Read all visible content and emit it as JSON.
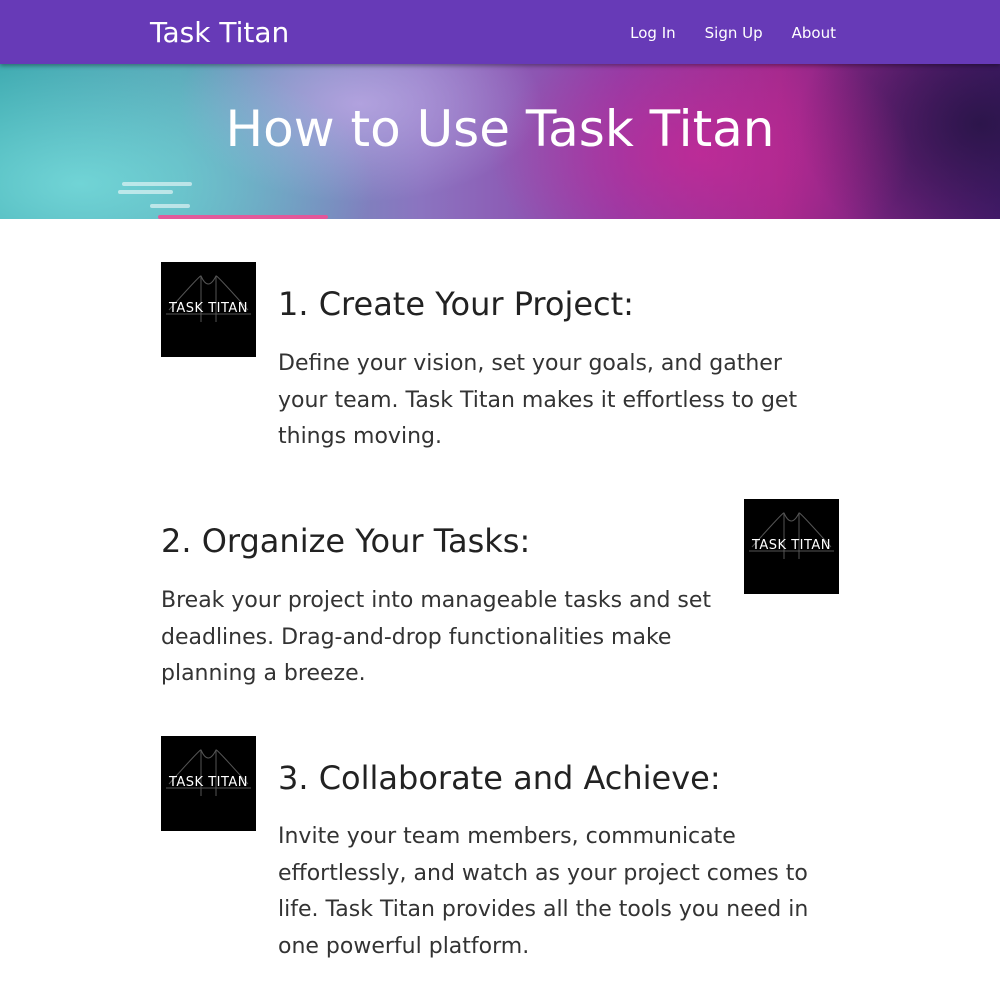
{
  "navbar": {
    "brand": "Task Titan",
    "links": [
      "Log In",
      "Sign Up",
      "About"
    ]
  },
  "hero": {
    "title": "How to Use Task Titan"
  },
  "logo_text": "TASK TITAN",
  "sections": [
    {
      "title": "1. Create Your Project:",
      "text": "Define your vision, set your goals, and gather your team. Task Titan makes it effortless to get things moving."
    },
    {
      "title": "2. Organize Your Tasks:",
      "text": "Break your project into manageable tasks and set deadlines. Drag-and-drop functionalities make planning a breeze."
    },
    {
      "title": "3. Collaborate and Achieve:",
      "text": "Invite your team members, communicate effortlessly, and watch as your project comes to life. Task Titan provides all the tools you need in one powerful platform."
    }
  ],
  "colors": {
    "navbar": "#673ab7",
    "logo_bg": "#000000",
    "text": "#222222"
  },
  "icons": {
    "logo": "task-titan-bridge-logo"
  }
}
